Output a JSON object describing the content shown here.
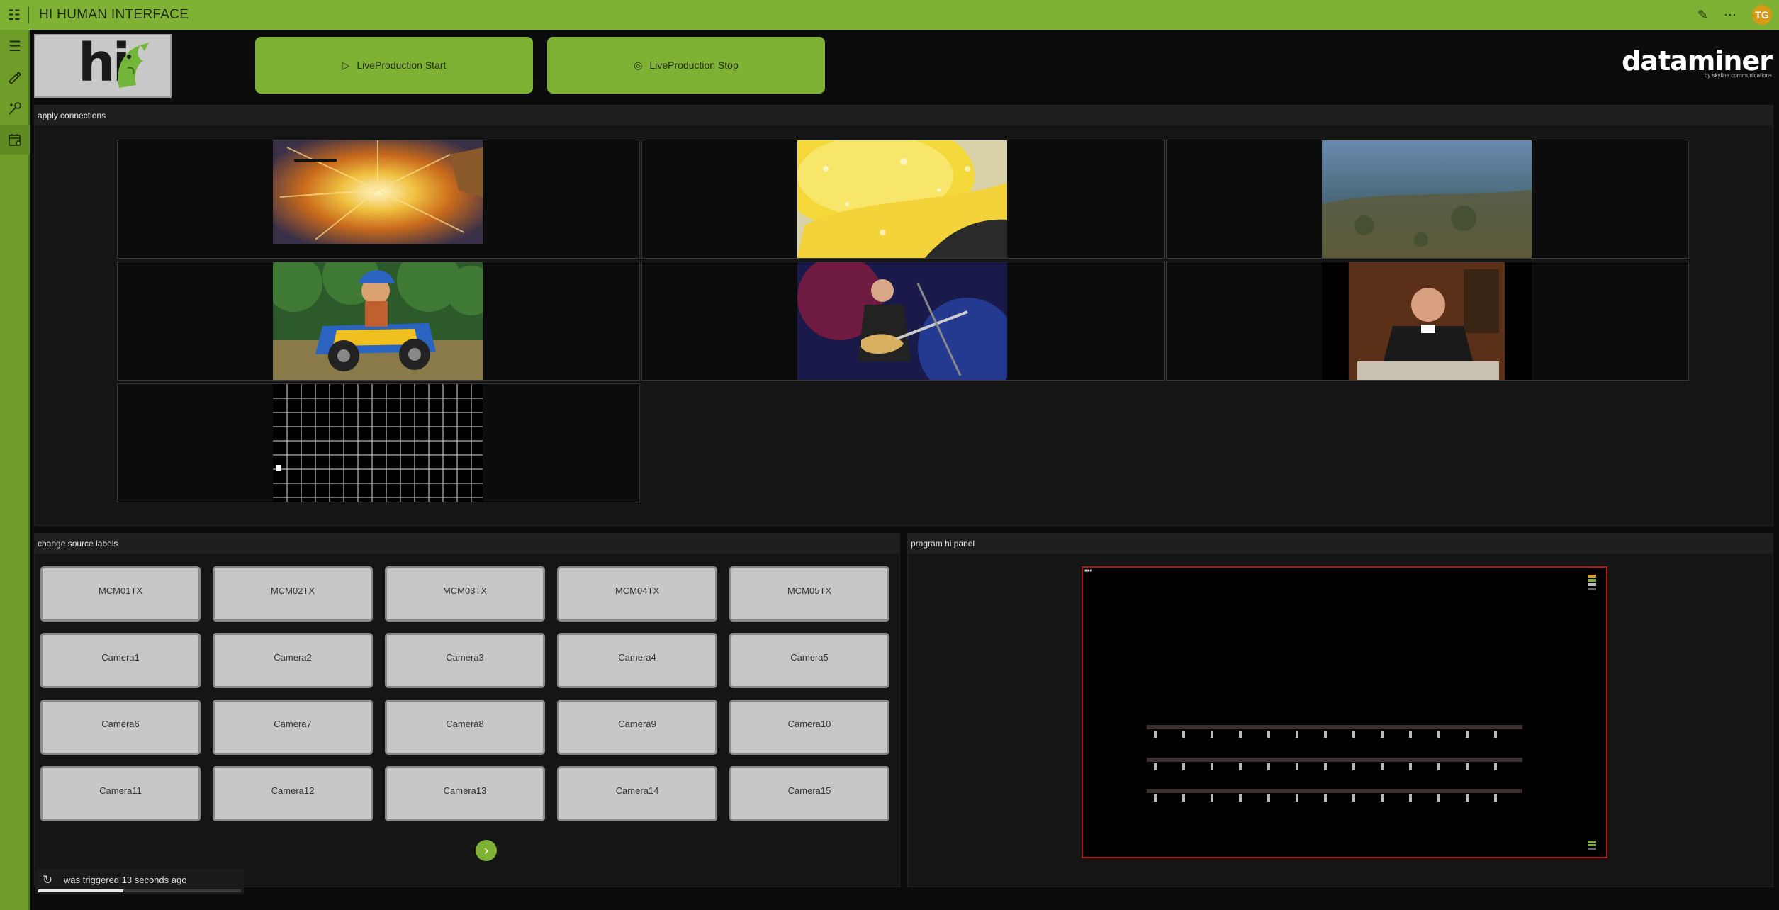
{
  "app": {
    "title": "HI HUMAN INTERFACE",
    "user_initials": "TG"
  },
  "header": {
    "logo_text": "hi",
    "start_button": "LiveProduction Start",
    "stop_button": "LiveProduction Stop",
    "brand_name": "dataminer",
    "brand_sub": "by skyline communications"
  },
  "connections": {
    "title": "apply connections",
    "sources": [
      {
        "name": "explosion"
      },
      {
        "name": "lemon"
      },
      {
        "name": "underwater"
      },
      {
        "name": "cartoon-truck"
      },
      {
        "name": "guitarist"
      },
      {
        "name": "speaker"
      },
      {
        "name": "test-grid"
      }
    ]
  },
  "labels": {
    "title": "change source labels",
    "buttons": [
      "MCM01TX",
      "MCM02TX",
      "MCM03TX",
      "MCM04TX",
      "MCM05TX",
      "Camera1",
      "Camera2",
      "Camera3",
      "Camera4",
      "Camera5",
      "Camera6",
      "Camera7",
      "Camera8",
      "Camera9",
      "Camera10",
      "Camera11",
      "Camera12",
      "Camera13",
      "Camera14",
      "Camera15"
    ]
  },
  "program": {
    "title": "program hi panel"
  },
  "status": {
    "trigger_text": "was triggered 13 seconds ago",
    "progress": 0.42
  },
  "colors": {
    "accent": "#7fb234",
    "program_border": "#b01818"
  }
}
